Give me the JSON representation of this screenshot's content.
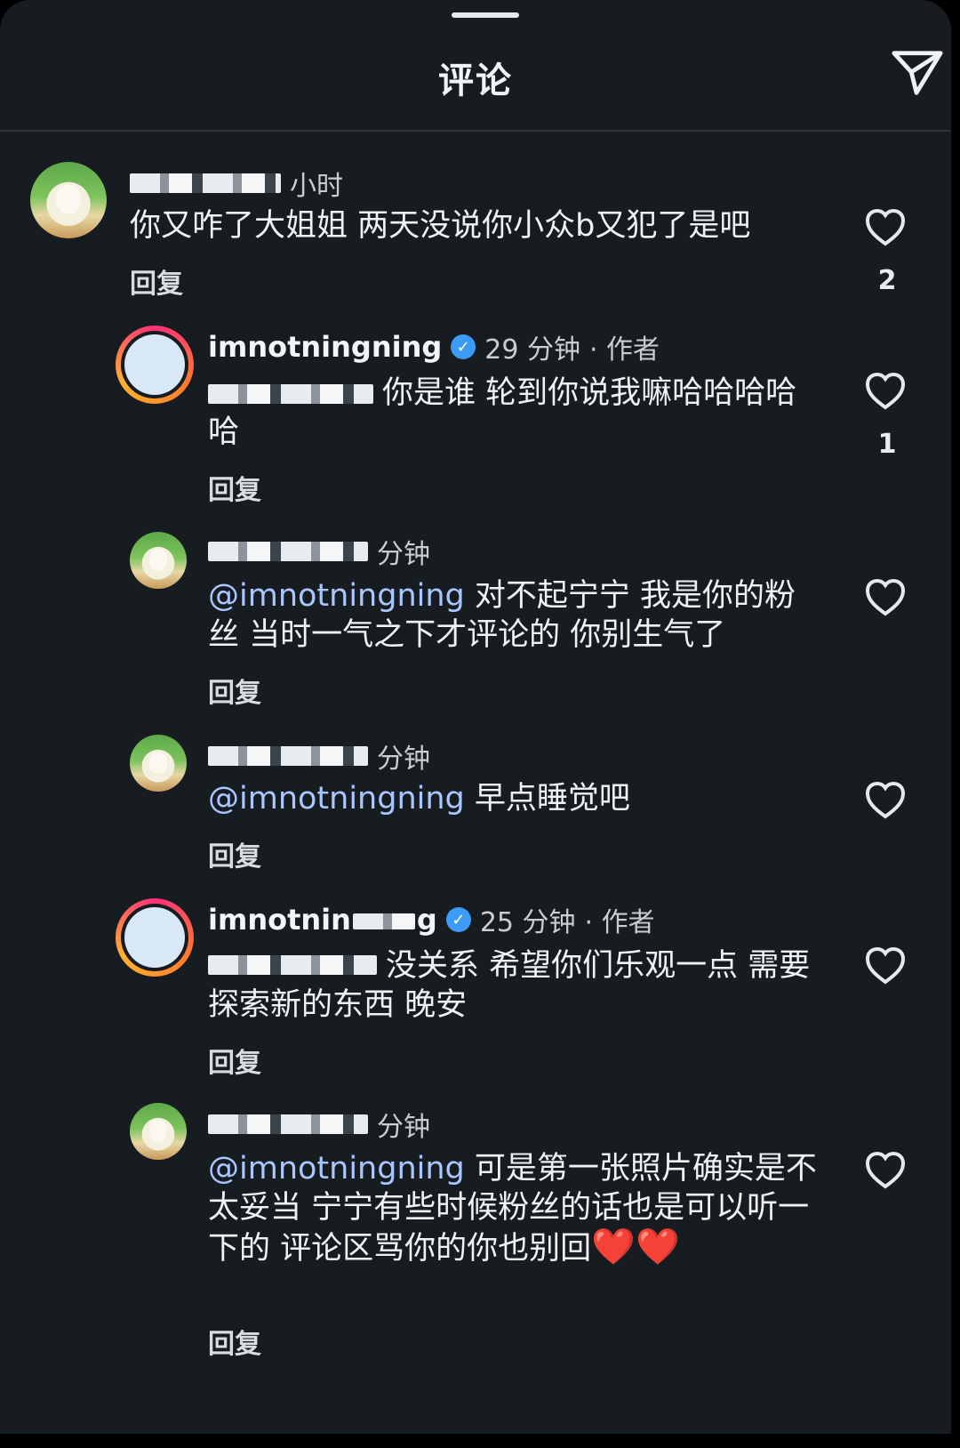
{
  "header": {
    "title": "评论"
  },
  "comments": [
    {
      "time": "小时",
      "text": "你又咋了大姐姐 两天没说你小众b又犯了是吧",
      "reply": "回复",
      "likes": "2"
    },
    {
      "username": "imnotningning",
      "time": "29 分钟",
      "author_tag": "· 作者",
      "text": "你是谁 轮到你说我嘛哈哈哈哈哈",
      "reply": "回复",
      "likes": "1"
    },
    {
      "time": "分钟",
      "mention": "@imnotningning",
      "text": " 对不起宁宁 我是你的粉丝 当时一气之下才评论的 你别生气了",
      "reply": "回复"
    },
    {
      "time": "分钟",
      "mention": "@imnotningning",
      "text": " 早点睡觉吧",
      "reply": "回复"
    },
    {
      "username": "imnotnin",
      "username_tail": "g",
      "time": "25 分钟",
      "author_tag": "· 作者",
      "text": "没关系 希望你们乐观一点 需要探索新的东西 晚安",
      "reply": "回复"
    },
    {
      "time": "分钟",
      "mention": "@imnotningning",
      "text": " 可是第一张照片确实是不太妥当 宁宁有些时候粉丝的话也是可以听一下的 评论区骂你的你也别回",
      "emoji": "❤️❤️",
      "reply": "回复"
    }
  ],
  "icons": {
    "share": "send-icon",
    "like": "heart-outline-icon",
    "verified": "verified-badge-icon"
  },
  "colors": {
    "background": "#171c21",
    "mention": "#a9c6ff",
    "verified": "#3b9bf5",
    "story_ring": "#ff2f7a"
  }
}
